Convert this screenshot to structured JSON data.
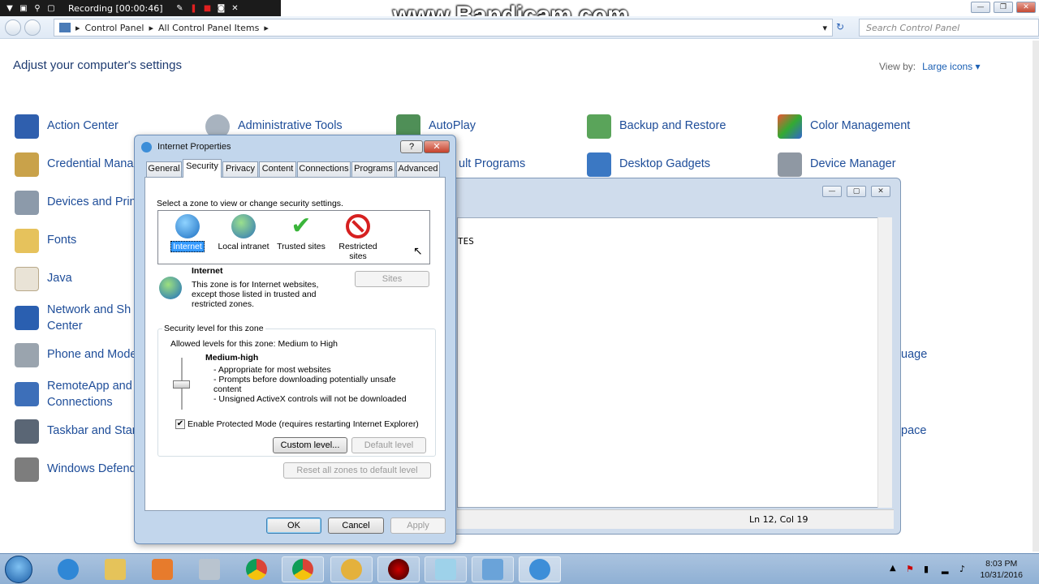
{
  "recording_bar": {
    "text": "Recording [00:00:46]"
  },
  "watermark": "www.Bandicam.com",
  "address": {
    "crumbs": [
      "Control Panel",
      "All Control Panel Items"
    ],
    "search_placeholder": "Search Control Panel"
  },
  "heading": "Adjust your computer's settings",
  "view_by": {
    "label": "View by:",
    "value": "Large icons"
  },
  "cp_items": {
    "col1": [
      "Action Center",
      "Credential Mana",
      "Devices and Prin",
      "Fonts",
      "Java",
      "Network and Sh",
      "Center",
      "Phone and Mode",
      "RemoteApp and",
      "Connections",
      "Taskbar and Star",
      "Windows Defend"
    ],
    "col2": [
      "Administrative Tools"
    ],
    "col3": [
      "AutoPlay",
      "ult Programs"
    ],
    "col4": [
      "Backup and Restore",
      "Desktop Gadgets"
    ],
    "col5": [
      "Color Management",
      "Device Manager"
    ],
    "partial_right": [
      "uage",
      "pace"
    ]
  },
  "bg_window": {
    "text": "TES",
    "status": "Ln 12, Col 19"
  },
  "dialog": {
    "title": "Internet Properties",
    "tabs": [
      "General",
      "Security",
      "Privacy",
      "Content",
      "Connections",
      "Programs",
      "Advanced"
    ],
    "zone_prompt": "Select a zone to view or change security settings.",
    "zones": [
      "Internet",
      "Local intranet",
      "Trusted sites",
      "Restricted sites"
    ],
    "zone_title": "Internet",
    "zone_desc": "This zone is for Internet websites, except those listed in trusted and restricted zones.",
    "sites_button": "Sites",
    "security_group": "Security level for this zone",
    "allowed_levels": "Allowed levels for this zone: Medium to High",
    "level_name": "Medium-high",
    "level_bullets": [
      "- Appropriate for most websites",
      "- Prompts before downloading potentially unsafe content",
      "- Unsigned ActiveX controls will not be downloaded"
    ],
    "protected_mode": "Enable Protected Mode (requires restarting Internet Explorer)",
    "custom_level": "Custom level...",
    "default_level": "Default level",
    "reset_all": "Reset all zones to default level",
    "ok": "OK",
    "cancel": "Cancel",
    "apply": "Apply"
  },
  "clock": {
    "time": "8:03 PM",
    "date": "10/31/2016"
  }
}
